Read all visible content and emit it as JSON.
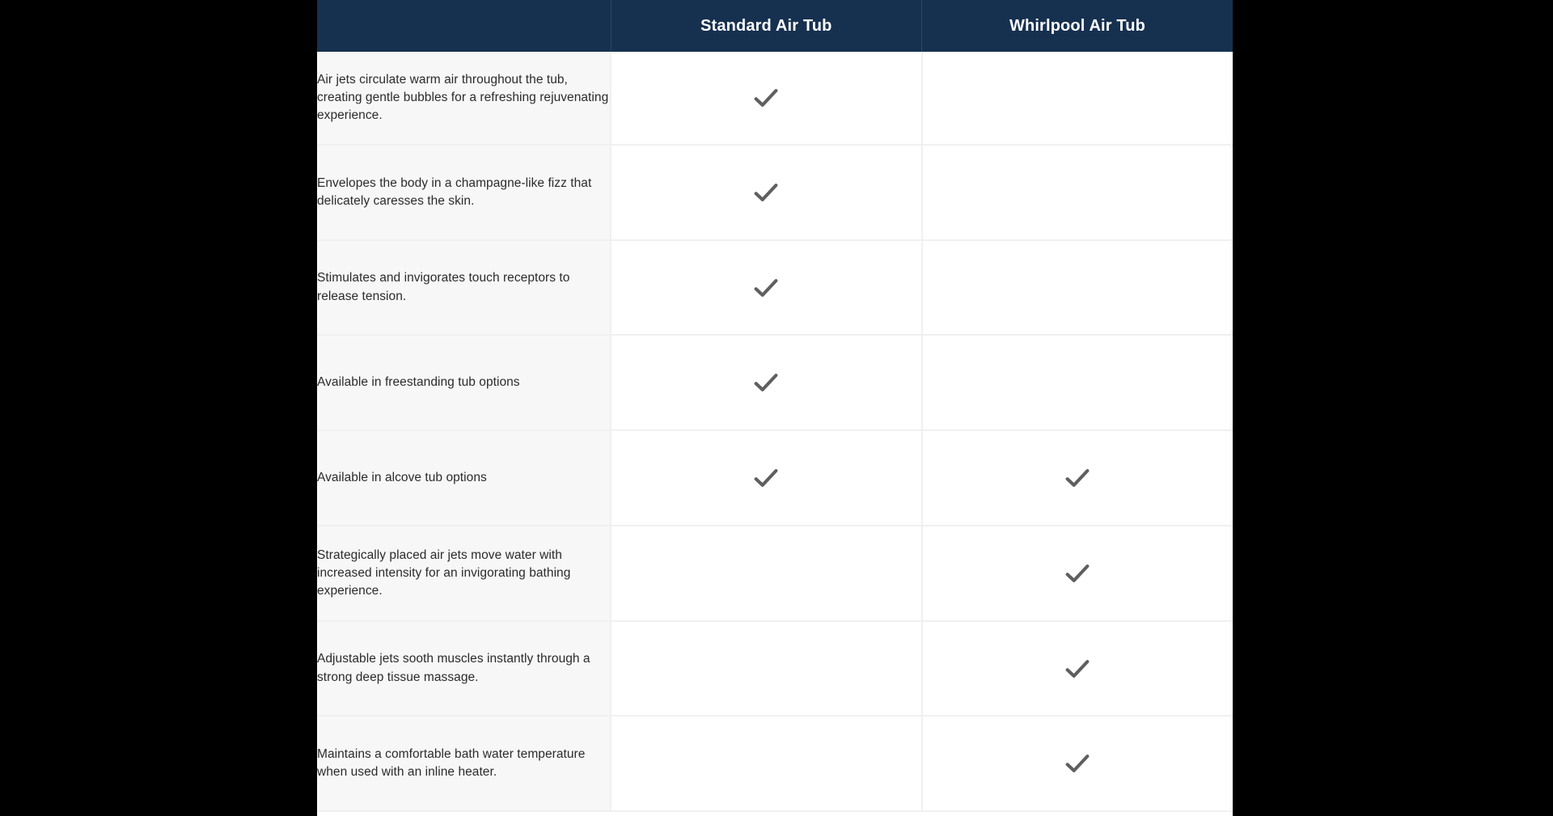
{
  "table": {
    "columns": [
      {
        "key": "feature",
        "label": ""
      },
      {
        "key": "standard",
        "label": "Standard Air Tub"
      },
      {
        "key": "whirlpool",
        "label": "Whirlpool Air Tub"
      }
    ],
    "header_background": "#16304f",
    "header_text_color": "#ffffff",
    "feature_column_background": "#f7f7f7",
    "value_column_background": "#ffffff",
    "check_color": "#5f5f5f",
    "row_divider_color": "#f0f0f0",
    "page_background": "#000000",
    "check_glyph": "checkmark-icon",
    "rows": [
      {
        "feature": "Air jets circulate warm air throughout the tub, creating gentle bubbles for a refreshing rejuvenating experience.",
        "standard": true,
        "whirlpool": false
      },
      {
        "feature": "Envelopes the body in a champagne-like fizz that delicately caresses the skin.",
        "standard": true,
        "whirlpool": false
      },
      {
        "feature": "Stimulates and invigorates touch receptors to release tension.",
        "standard": true,
        "whirlpool": false
      },
      {
        "feature": "Available in freestanding tub options",
        "standard": true,
        "whirlpool": false
      },
      {
        "feature": "Available in alcove tub options",
        "standard": true,
        "whirlpool": true
      },
      {
        "feature": "Strategically placed air jets move water with increased intensity for an invigorating bathing experience.",
        "standard": false,
        "whirlpool": true
      },
      {
        "feature": "Adjustable jets sooth muscles instantly through a strong deep tissue massage.",
        "standard": false,
        "whirlpool": true
      },
      {
        "feature": "Maintains a comfortable bath water temperature when used with an inline heater.",
        "standard": false,
        "whirlpool": true
      }
    ]
  }
}
